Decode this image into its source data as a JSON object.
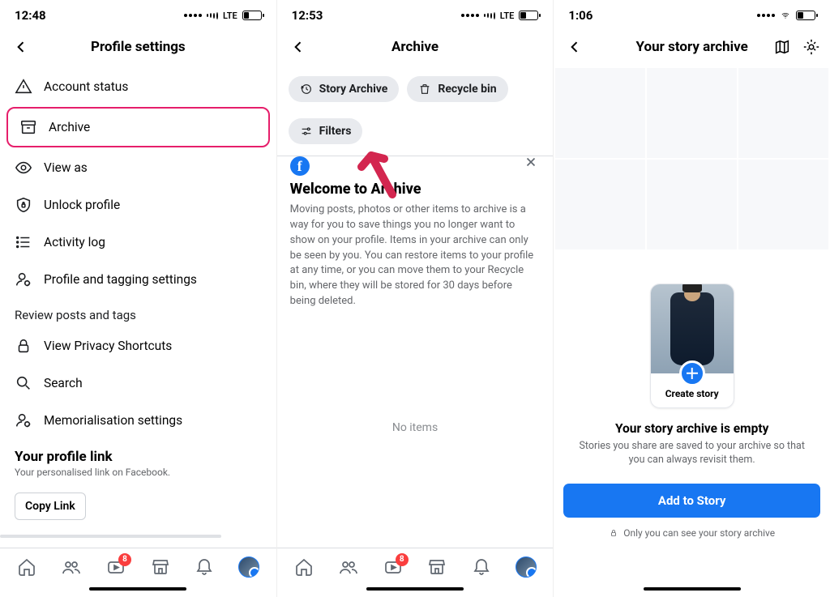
{
  "screen1": {
    "time": "12:48",
    "network": "LTE",
    "title": "Profile settings",
    "items": [
      {
        "key": "account-status",
        "label": "Account status"
      },
      {
        "key": "archive",
        "label": "Archive",
        "highlighted": true
      },
      {
        "key": "view-as",
        "label": "View as"
      },
      {
        "key": "unlock-profile",
        "label": "Unlock profile"
      },
      {
        "key": "activity-log",
        "label": "Activity log"
      },
      {
        "key": "profile-tagging",
        "label": "Profile and tagging settings"
      }
    ],
    "section_label": "Review posts and tags",
    "items2": [
      {
        "key": "privacy-shortcuts",
        "label": "View Privacy Shortcuts"
      },
      {
        "key": "search",
        "label": "Search"
      },
      {
        "key": "memorialisation",
        "label": "Memorialisation settings"
      }
    ],
    "profile_link": {
      "heading": "Your profile link",
      "sub": "Your personalised link on Facebook."
    },
    "copy_link": "Copy Link",
    "tab_badge": "8"
  },
  "screen2": {
    "time": "12:53",
    "network": "LTE",
    "title": "Archive",
    "chips": {
      "story": "Story Archive",
      "recycle": "Recycle bin"
    },
    "filters": "Filters",
    "welcome": {
      "heading": "Welcome to Archive",
      "body": "Moving posts, photos or other items to archive is a way for you to save things you no longer want to show on your profile. Items in your archive can only be seen by you. You can restore items to your profile at any time, or you can move them to your Recycle bin, where they will be stored for 30 days before being deleted."
    },
    "no_items": "No items",
    "tab_badge": "8"
  },
  "screen3": {
    "time": "1:06",
    "title": "Your story archive",
    "create_story": "Create story",
    "empty": {
      "heading": "Your story archive is empty",
      "body": "Stories you share are saved to your archive so that you can always revisit them."
    },
    "add_btn": "Add to Story",
    "only_you": "Only you can see your story archive"
  }
}
